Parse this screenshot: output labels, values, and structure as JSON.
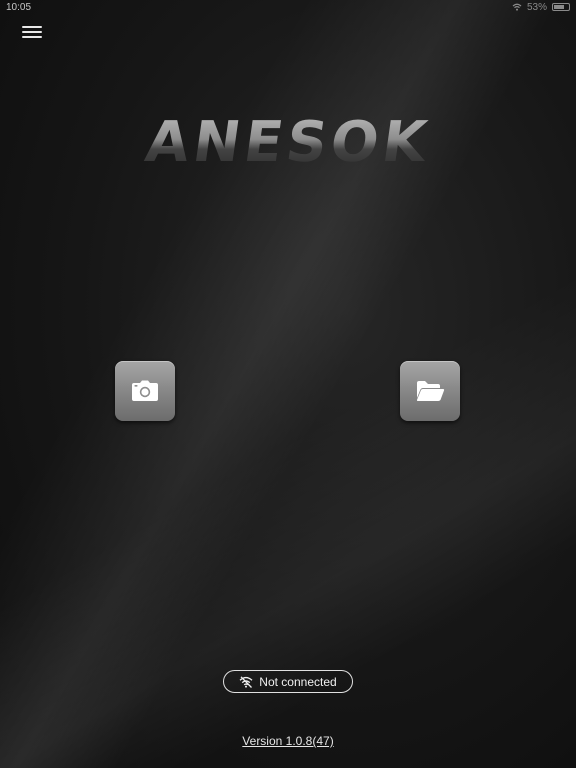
{
  "status_bar": {
    "time": "10:05",
    "battery_text": "53%"
  },
  "menu": {
    "icon": "hamburger-menu-icon"
  },
  "logo": {
    "text": "ANESOK"
  },
  "actions": {
    "camera": {
      "icon": "camera-icon"
    },
    "folder": {
      "icon": "folder-open-icon"
    }
  },
  "connection": {
    "icon": "wifi-off-icon",
    "label": "Not connected"
  },
  "footer": {
    "version": "Version 1.0.8(47)"
  }
}
